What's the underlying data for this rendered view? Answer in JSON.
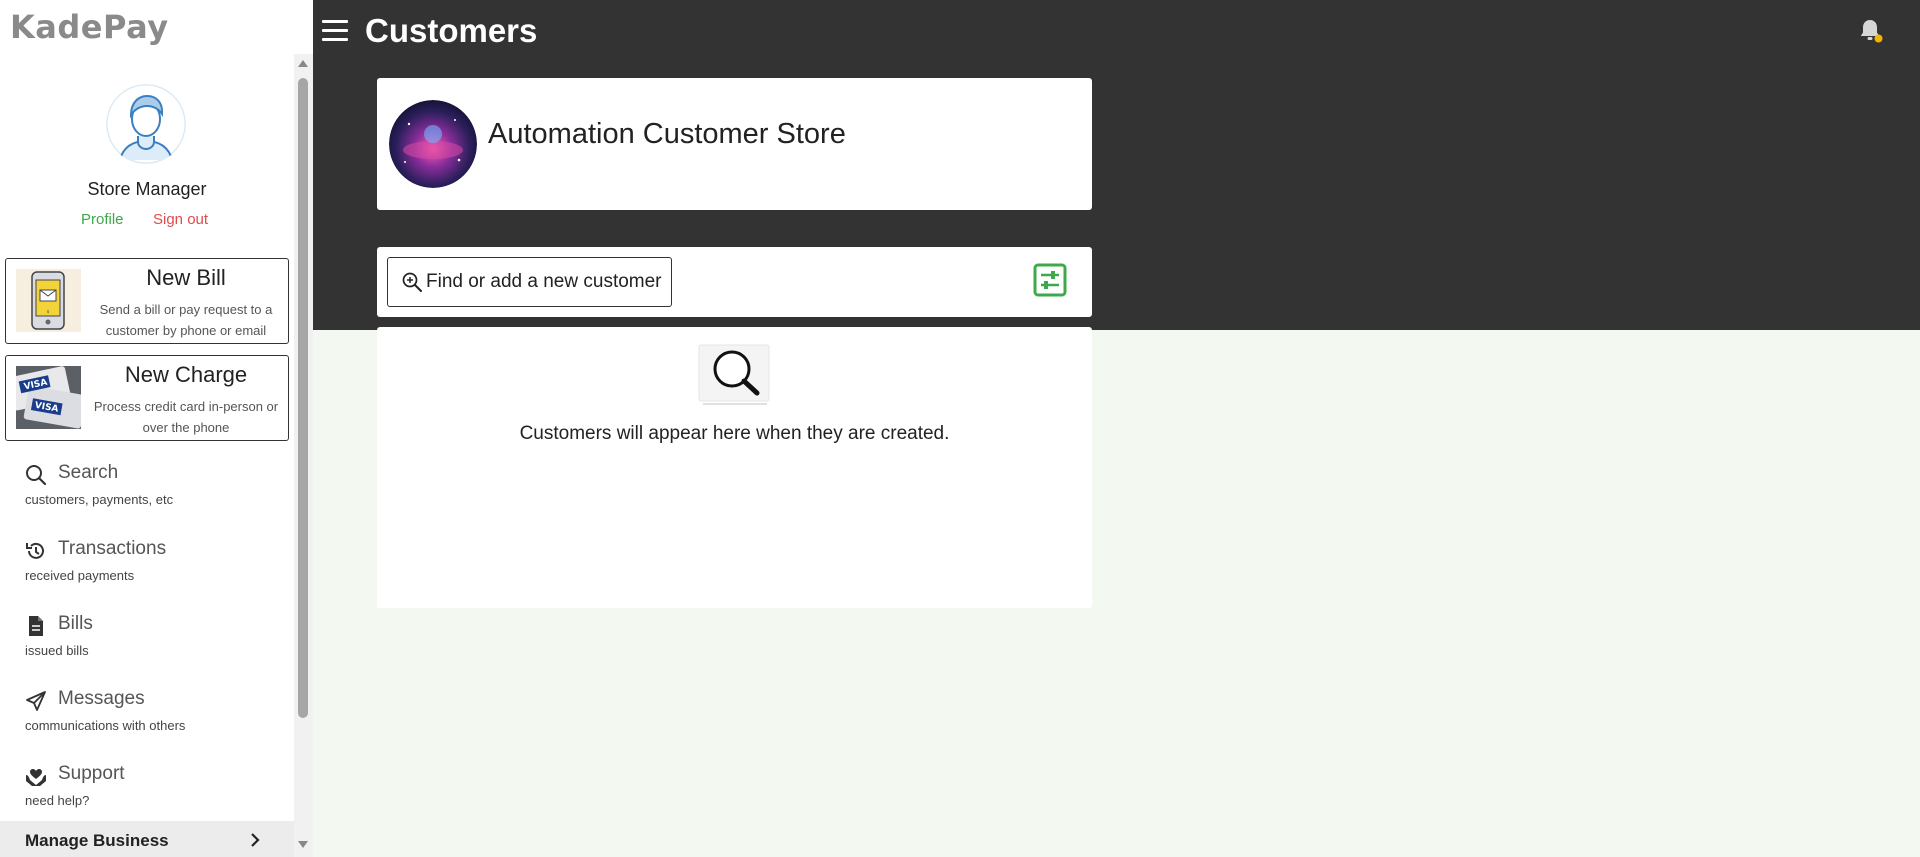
{
  "app": {
    "logo_text": "KadePay"
  },
  "header": {
    "title": "Customers",
    "menu_icon": "hamburger-icon",
    "notification_icon": "bell-icon",
    "notification_dot_color": "#f5b400"
  },
  "sidebar": {
    "user_name": "Store Manager",
    "profile_label": "Profile",
    "signout_label": "Sign out",
    "actions": [
      {
        "title": "New Bill",
        "description": "Send a bill or pay request to a customer by phone or email",
        "icon": "phone-bill-icon"
      },
      {
        "title": "New Charge",
        "description": "Process credit card in-person or over the phone",
        "icon": "credit-cards-icon"
      }
    ],
    "items": [
      {
        "label": "Search",
        "sub": "customers, payments, etc",
        "icon": "search-icon"
      },
      {
        "label": "Transactions",
        "sub": "received payments",
        "icon": "history-icon"
      },
      {
        "label": "Bills",
        "sub": "issued bills",
        "icon": "document-icon"
      },
      {
        "label": "Messages",
        "sub": "communications with others",
        "icon": "paper-plane-icon"
      },
      {
        "label": "Support",
        "sub": "need help?",
        "icon": "support-hands-icon"
      }
    ],
    "manage_business_label": "Manage Business"
  },
  "main": {
    "store_name": "Automation Customer Store",
    "find_customer_label": "Find or add a new customer",
    "empty_message": "Customers will appear here when they are created."
  },
  "colors": {
    "header_bg": "#333333",
    "accent_green": "#3ea84a",
    "signout_red": "#e04b4b",
    "page_bg": "#f3f9f1"
  }
}
